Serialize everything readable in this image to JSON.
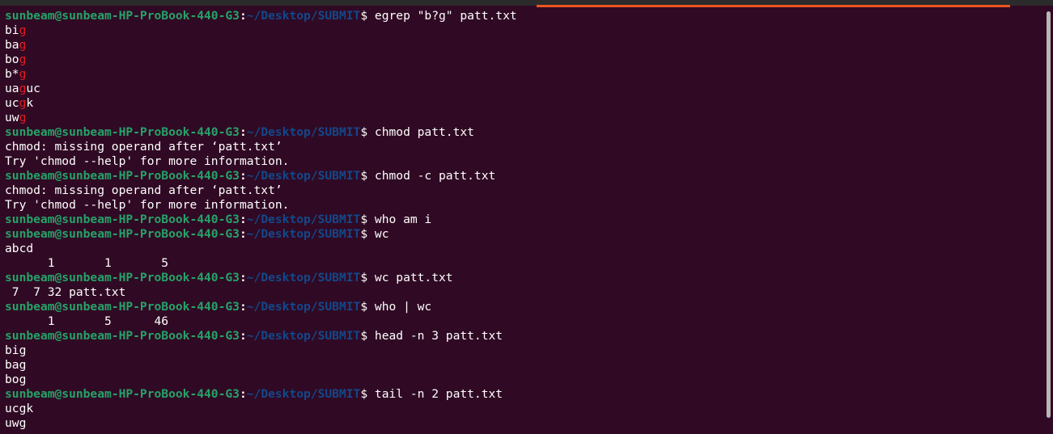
{
  "prompt": {
    "user_host": "sunbeam@sunbeam-HP-ProBook-440-G3",
    "colon": ":",
    "path": "~/Desktop/SUBMIT",
    "dollar": "$ "
  },
  "lines": [
    {
      "type": "prompt",
      "cmd": "egrep \"b?g\" patt.txt"
    },
    {
      "type": "match",
      "pre": "bi",
      "hl": "g",
      "post": ""
    },
    {
      "type": "match",
      "pre": "ba",
      "hl": "g",
      "post": ""
    },
    {
      "type": "match",
      "pre": "bo",
      "hl": "g",
      "post": ""
    },
    {
      "type": "match",
      "pre": "b*",
      "hl": "g",
      "post": ""
    },
    {
      "type": "match",
      "pre": "ua",
      "hl": "g",
      "post": "uc"
    },
    {
      "type": "match",
      "pre": "uc",
      "hl": "g",
      "post": "k"
    },
    {
      "type": "match",
      "pre": "uw",
      "hl": "g",
      "post": ""
    },
    {
      "type": "prompt",
      "cmd": "chmod patt.txt"
    },
    {
      "type": "out",
      "text": "chmod: missing operand after ‘patt.txt’"
    },
    {
      "type": "out",
      "text": "Try 'chmod --help' for more information."
    },
    {
      "type": "prompt",
      "cmd": "chmod -c patt.txt"
    },
    {
      "type": "out",
      "text": "chmod: missing operand after ‘patt.txt’"
    },
    {
      "type": "out",
      "text": "Try 'chmod --help' for more information."
    },
    {
      "type": "prompt",
      "cmd": "who am i"
    },
    {
      "type": "prompt",
      "cmd": "wc"
    },
    {
      "type": "out",
      "text": "abcd"
    },
    {
      "type": "out",
      "text": "      1       1       5"
    },
    {
      "type": "prompt",
      "cmd": "wc patt.txt"
    },
    {
      "type": "out",
      "text": " 7  7 32 patt.txt"
    },
    {
      "type": "prompt",
      "cmd": "who | wc"
    },
    {
      "type": "out",
      "text": "      1       5      46"
    },
    {
      "type": "prompt",
      "cmd": "head -n 3 patt.txt"
    },
    {
      "type": "out",
      "text": "big"
    },
    {
      "type": "out",
      "text": "bag"
    },
    {
      "type": "out",
      "text": "bog"
    },
    {
      "type": "prompt",
      "cmd": "tail -n 2 patt.txt"
    },
    {
      "type": "out",
      "text": "ucgk"
    },
    {
      "type": "out",
      "text": "uwg"
    }
  ],
  "colors": {
    "background": "#300a24",
    "prompt_user": "#26a269",
    "prompt_path": "#12488b",
    "match_highlight": "#e01b24",
    "tab_accent": "#e95420"
  }
}
